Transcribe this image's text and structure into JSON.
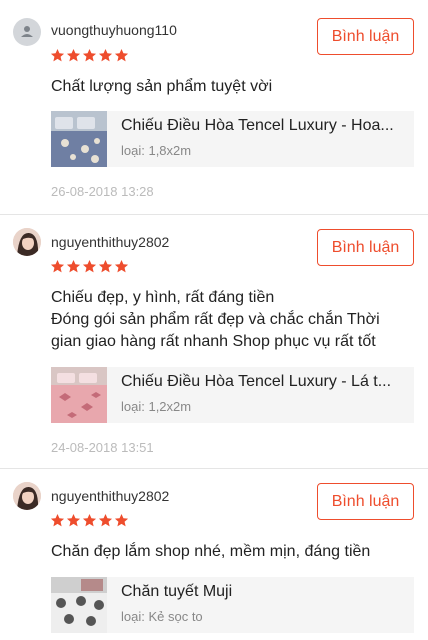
{
  "colors": {
    "accent": "#ee4d2d",
    "star": "#ee4d2d",
    "muted": "#bbbbbb"
  },
  "reviews": [
    {
      "username": "vuongthuyhuong110",
      "rating": 5,
      "avatar_icon": "default-user-icon",
      "button_label": "Bình luận",
      "comment_lines": [
        "Chất lượng sản phẩm tuyệt vời"
      ],
      "product_name": "Chiếu Điều Hòa Tencel Luxury - Hoa...",
      "variant": "loại: 1,8x2m",
      "timestamp": "26-08-2018 13:28"
    },
    {
      "username": "nguyenthithuy2802",
      "rating": 5,
      "avatar_icon": "user-photo",
      "button_label": "Bình luận",
      "comment_lines": [
        "Chiếu đẹp, y hình, rất đáng tiền",
        "Đóng gói sản phẩm rất đẹp và chắc chắn Thời",
        "gian giao hàng rất nhanh Shop phục vụ rất tốt"
      ],
      "product_name": "Chiếu Điều Hòa Tencel Luxury - Lá t...",
      "variant": "loại: 1,2x2m",
      "timestamp": "24-08-2018 13:51"
    },
    {
      "username": "nguyenthithuy2802",
      "rating": 5,
      "avatar_icon": "user-photo",
      "button_label": "Bình luận",
      "comment_lines": [
        "Chăn đẹp lắm shop nhé, mềm mịn, đáng tiền"
      ],
      "product_name": "Chăn tuyết Muji",
      "variant": "loại: Kẻ sọc to"
    }
  ]
}
